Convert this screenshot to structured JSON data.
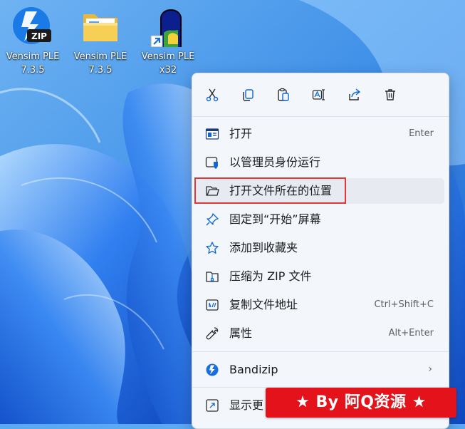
{
  "desktop": {
    "icons": [
      {
        "label": "Vensim PLE\n7.3.5",
        "icon": "bandizip-zip-icon"
      },
      {
        "label": "Vensim PLE\n7.3.5",
        "icon": "folder-icon"
      },
      {
        "label": "Vensim PLE\nx32",
        "icon": "vensim-app-shortcut-icon"
      }
    ]
  },
  "context_menu": {
    "quick_actions": [
      {
        "name": "cut",
        "icon": "scissors-icon"
      },
      {
        "name": "copy",
        "icon": "copy-icon"
      },
      {
        "name": "paste",
        "icon": "clipboard-icon"
      },
      {
        "name": "rename",
        "icon": "rename-icon"
      },
      {
        "name": "share",
        "icon": "share-icon"
      },
      {
        "name": "delete",
        "icon": "trash-icon"
      }
    ],
    "items": [
      {
        "label": "打开",
        "accelerator": "Enter",
        "icon": "open-window-icon"
      },
      {
        "label": "以管理员身份运行",
        "accelerator": "",
        "icon": "shield-icon"
      },
      {
        "label": "打开文件所在的位置",
        "accelerator": "",
        "icon": "folder-open-icon",
        "highlighted": true
      },
      {
        "label": "固定到“开始”屏幕",
        "accelerator": "",
        "icon": "pin-icon"
      },
      {
        "label": "添加到收藏夹",
        "accelerator": "",
        "icon": "star-icon"
      },
      {
        "label": "压缩为 ZIP 文件",
        "accelerator": "",
        "icon": "zip-folder-icon"
      },
      {
        "label": "复制文件地址",
        "accelerator": "Ctrl+Shift+C",
        "icon": "copy-path-icon"
      },
      {
        "label": "属性",
        "accelerator": "Alt+Enter",
        "icon": "wrench-icon"
      },
      {
        "label": "Bandizip",
        "accelerator": "",
        "icon": "bandizip-icon",
        "submenu": true
      },
      {
        "label": "显示更",
        "accelerator": "",
        "icon": "show-more-icon"
      }
    ]
  },
  "watermark": {
    "text": "★ By 阿Q资源 ★"
  },
  "colors": {
    "accent": "#1067d3",
    "highlight_border": "#e23737",
    "watermark_bg": "#e4131b"
  }
}
